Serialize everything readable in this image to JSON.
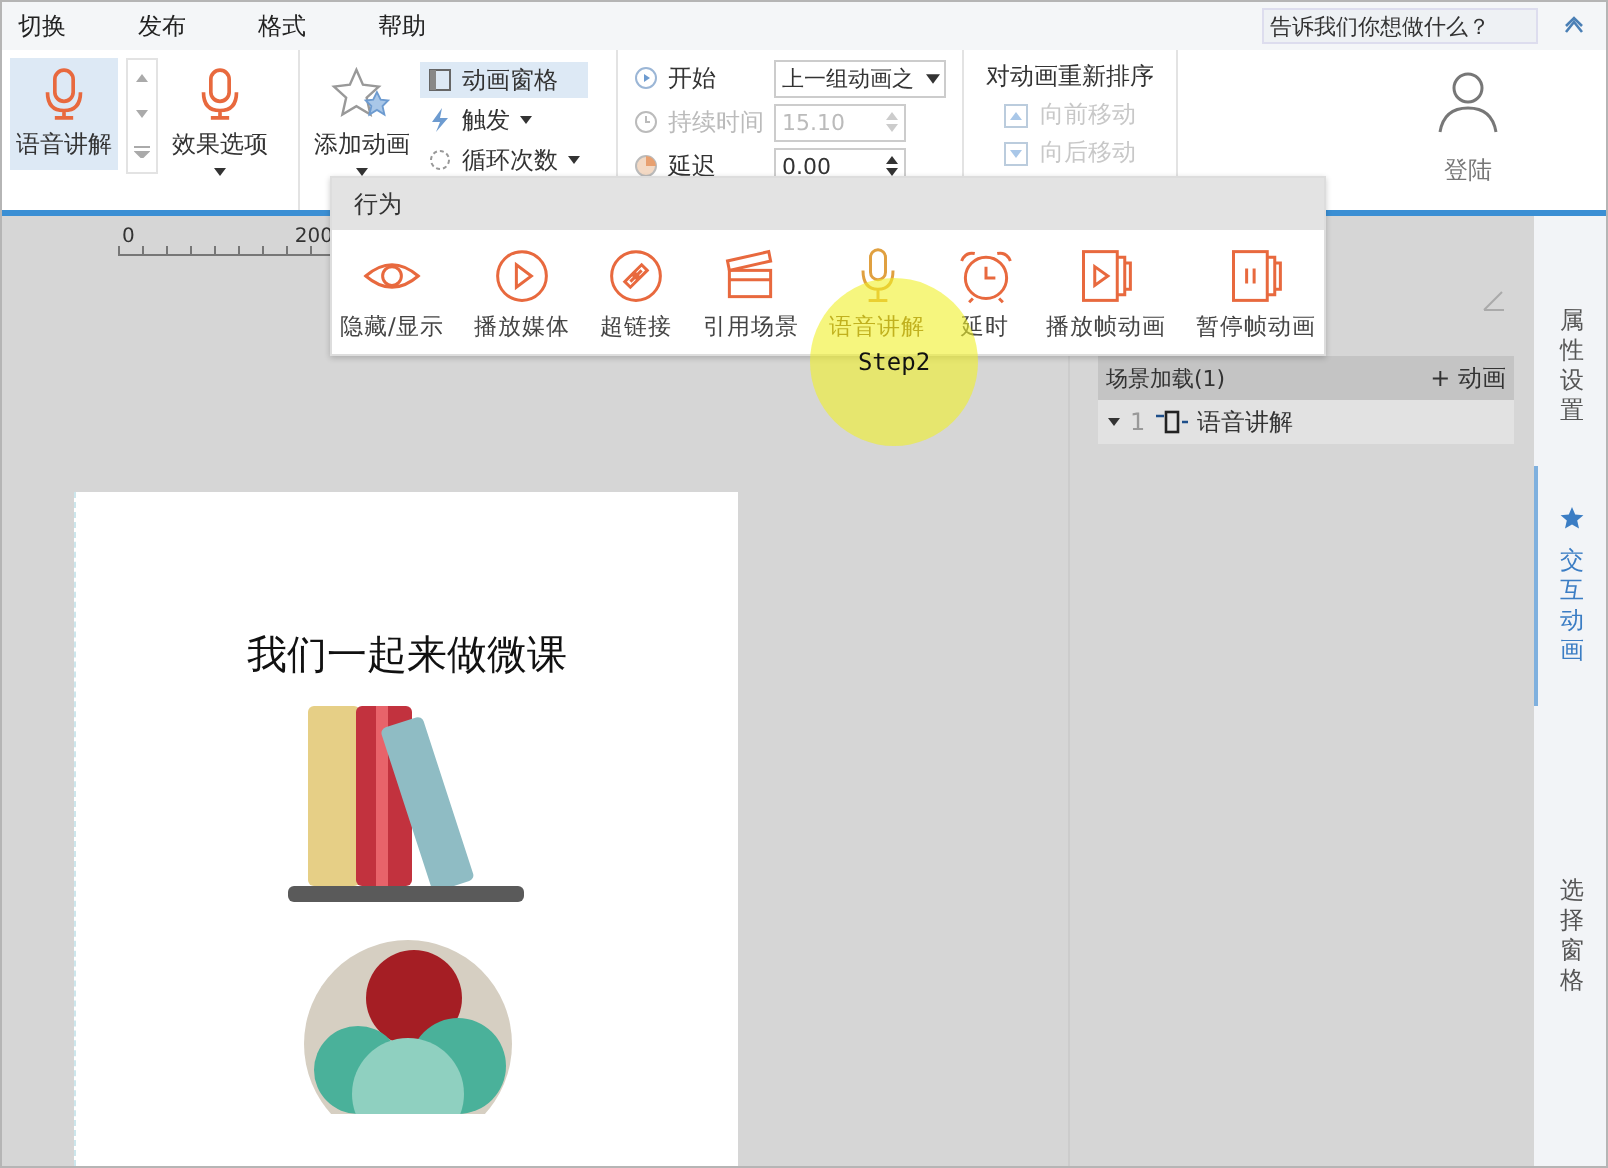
{
  "menu": [
    {
      "label": "切换"
    },
    {
      "label": "发布"
    },
    {
      "label": "格式"
    },
    {
      "label": "帮助"
    }
  ],
  "search": {
    "placeholder": "告诉我们你想做什么？"
  },
  "ribbon": {
    "voice_button": {
      "label": "语音讲解",
      "selected": true
    },
    "effect_options": {
      "label": "效果选项"
    },
    "add_animation": {
      "label": "添加动画"
    },
    "small_buttons": [
      {
        "label": "动画窗格",
        "selected": true,
        "kind": "pane",
        "dropdown": false
      },
      {
        "label": "触发",
        "selected": false,
        "kind": "trigger",
        "dropdown": true
      },
      {
        "label": "循环次数",
        "selected": false,
        "kind": "loop",
        "dropdown": true
      }
    ],
    "timing": [
      {
        "label": "开始",
        "value": "上一组动画之",
        "disabled": false,
        "kind": "start"
      },
      {
        "label": "持续时间",
        "value": "15.10",
        "disabled": true,
        "kind": "duration"
      },
      {
        "label": "延迟",
        "value": "0.00",
        "disabled": false,
        "kind": "delay"
      }
    ],
    "reorder": {
      "title": "对动画重新排序",
      "buttons": [
        {
          "label": "向前移动",
          "disabled": true,
          "kind": "up"
        },
        {
          "label": "向后移动",
          "disabled": true,
          "kind": "down"
        }
      ]
    },
    "login": {
      "label": "登陆"
    }
  },
  "ruler": [
    "0",
    "200"
  ],
  "slide": {
    "title": "我们一起来做微课"
  },
  "animation_panel": {
    "header": "场景加载(1)",
    "add_label": "+ 动画",
    "items": [
      {
        "index": "1",
        "label": "语音讲解",
        "expanded": true
      }
    ]
  },
  "side_tabs": [
    {
      "label": "属性设置",
      "selected": false
    },
    {
      "label": "交互动画",
      "selected": true
    },
    {
      "label": "选择窗格",
      "selected": false
    }
  ],
  "popup": {
    "title": "行为",
    "items": [
      {
        "label": "隐藏/显示",
        "kind": "eye",
        "disabled": false
      },
      {
        "label": "播放媒体",
        "kind": "play",
        "disabled": false
      },
      {
        "label": "超链接",
        "kind": "link",
        "disabled": false
      },
      {
        "label": "引用场景",
        "kind": "clapper",
        "disabled": false
      },
      {
        "label": "语音讲解",
        "kind": "mic",
        "disabled": true
      },
      {
        "label": "延时",
        "kind": "alarm",
        "disabled": false
      },
      {
        "label": "播放帧动画",
        "kind": "frameplay",
        "disabled": false
      },
      {
        "label": "暂停帧动画",
        "kind": "framepause",
        "disabled": false
      }
    ]
  },
  "annotation": {
    "label": "Step2"
  }
}
